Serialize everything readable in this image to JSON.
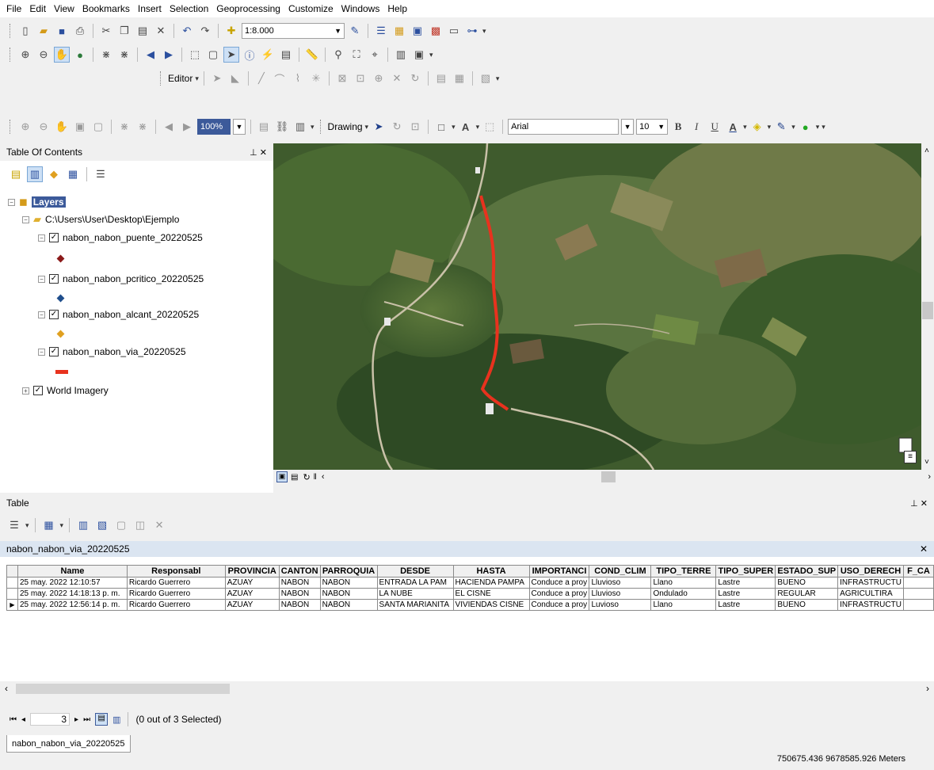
{
  "menu": [
    "File",
    "Edit",
    "View",
    "Bookmarks",
    "Insert",
    "Selection",
    "Geoprocessing",
    "Customize",
    "Windows",
    "Help"
  ],
  "toolbar": {
    "scale_value": "1:8.000",
    "editor_label": "Editor",
    "zoom_value": "100%",
    "drawing_label": "Drawing",
    "font_name": "Arial",
    "font_size": "10",
    "bold": "B",
    "italic": "I",
    "underline": "U",
    "text_color_letter": "A"
  },
  "toc": {
    "title": "Table Of Contents",
    "root": "Layers",
    "folder": "C:\\Users\\User\\Desktop\\Ejemplo",
    "layers": [
      {
        "name": "nabon_nabon_puente_20220525",
        "symbol": "diamond",
        "color": "#8b1a1a"
      },
      {
        "name": "nabon_nabon_pcritico_20220525",
        "symbol": "diamond",
        "color": "#1f4e8c"
      },
      {
        "name": "nabon_nabon_alcant_20220525",
        "symbol": "diamond",
        "color": "#e0a020"
      },
      {
        "name": "nabon_nabon_via_20220525",
        "symbol": "line",
        "color": "#e8321e"
      }
    ],
    "basemap": "World Imagery"
  },
  "map": {
    "road_color": "#e8321e"
  },
  "table": {
    "panel_title": "Table",
    "tab_name": "nabon_nabon_via_20220525",
    "columns": [
      "Name",
      "Responsabl",
      "PROVINCIA",
      "CANTON",
      "PARROQUIA",
      "DESDE",
      "HASTA",
      "IMPORTANCI",
      "COND_CLIM",
      "TIPO_TERRE",
      "TIPO_SUPER",
      "ESTADO_SUP",
      "USO_DERECH",
      "F_CA"
    ],
    "rows": [
      [
        "25 may. 2022 12:10:57",
        "Ricardo Guerrero",
        "AZUAY",
        "NABON",
        "NABON",
        "ENTRADA LA PAM",
        "HACIENDA PAMPA",
        "Conduce a proy",
        "Lluvioso",
        "Llano",
        "Lastre",
        "BUENO",
        "INFRASTRUCTU",
        ""
      ],
      [
        "25 may. 2022 14:18:13 p. m.",
        "Ricardo Guerrero",
        "AZUAY",
        "NABON",
        "NABON",
        "LA NUBE",
        "EL CISNE",
        "Conduce a proy",
        "Lluvioso",
        "Ondulado",
        "Lastre",
        "REGULAR",
        "AGRICULTIRA",
        ""
      ],
      [
        "25 may. 2022 12:56:14 p. m.",
        "Ricardo Guerrero",
        "AZUAY",
        "NABON",
        "NABON",
        "SANTA MARIANITA",
        "VIVIENDAS CISNE",
        "Conduce a proy",
        "Luvioso",
        "Llano",
        "Lastre",
        "BUENO",
        "INFRASTRUCTU",
        ""
      ]
    ],
    "current_record": "3",
    "selection_text": "(0 out of 3 Selected)",
    "bottom_tab": "nabon_nabon_via_20220525"
  },
  "status": {
    "coordinates": "750675.436  9678585.926 Meters"
  }
}
